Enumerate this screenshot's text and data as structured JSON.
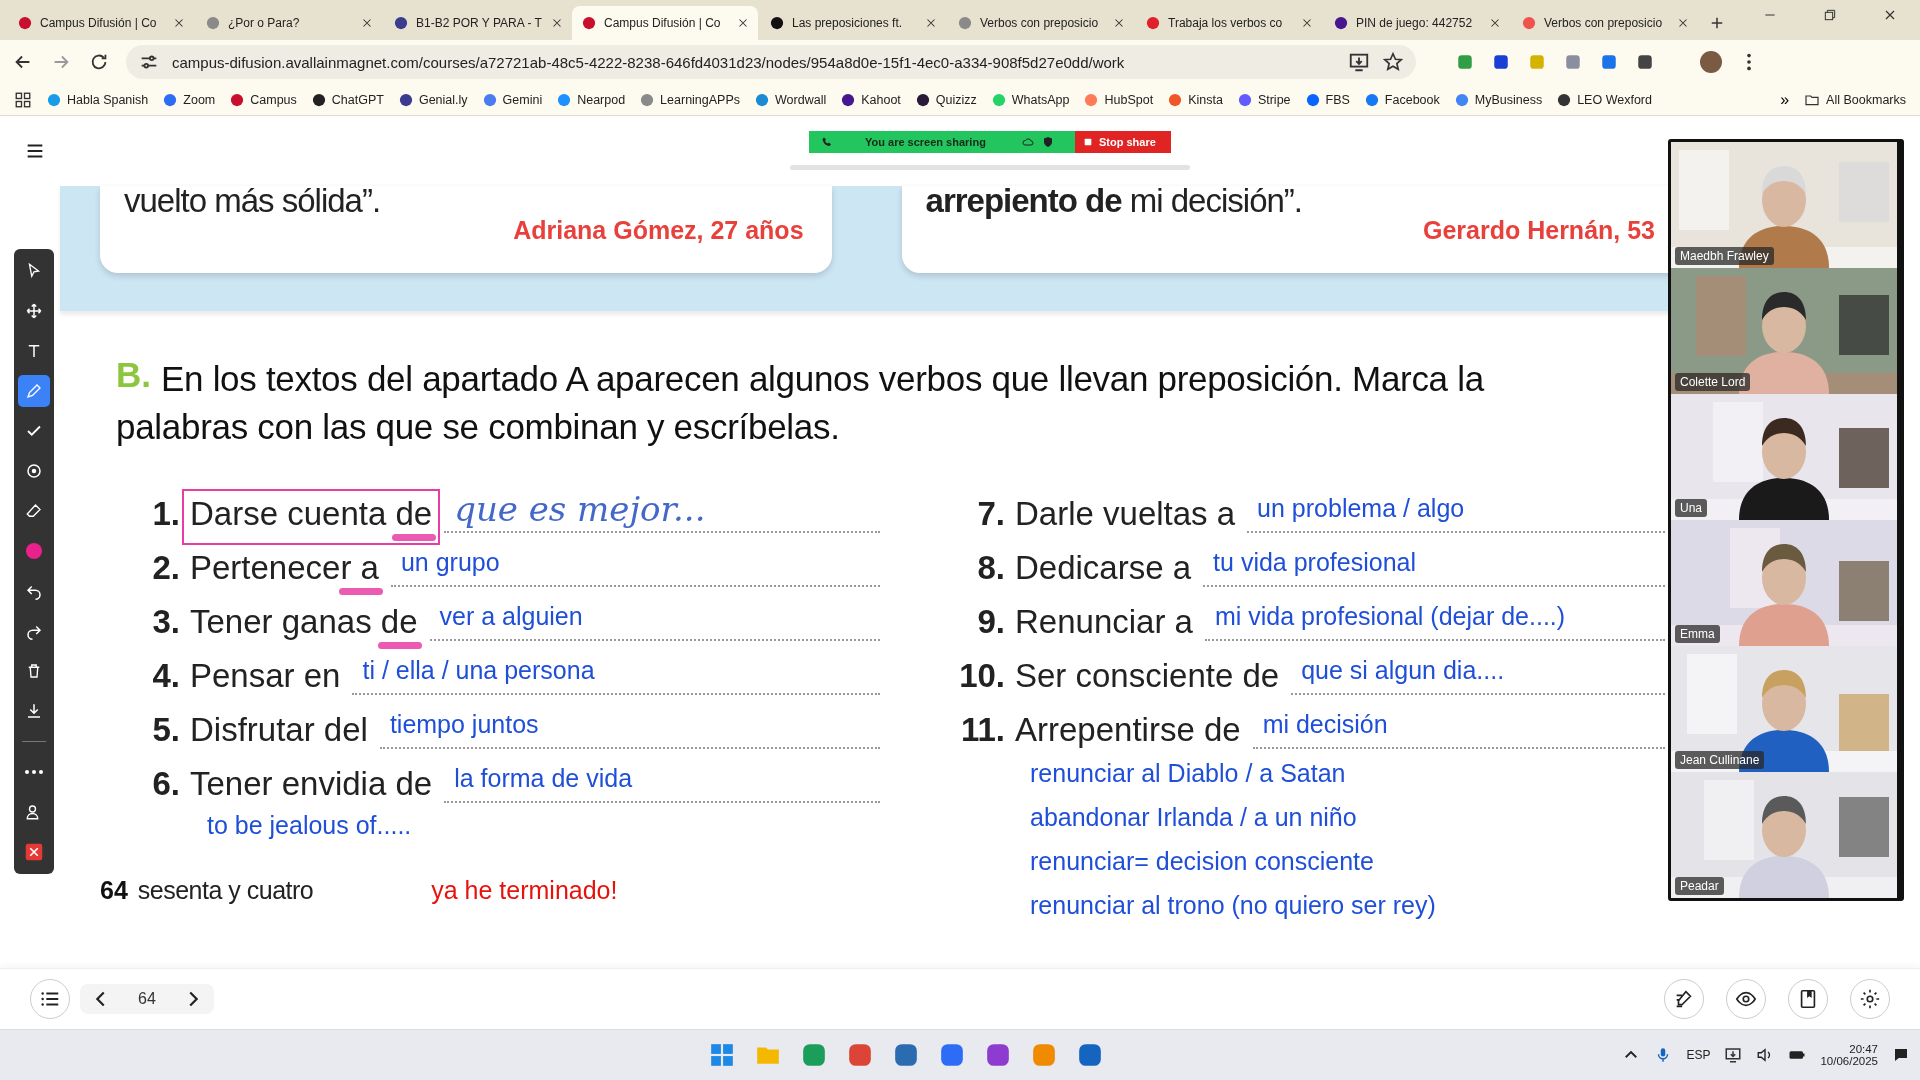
{
  "browser": {
    "tabs": [
      {
        "title": "Campus Difusión | Co",
        "selected": false,
        "color": "#c8102e"
      },
      {
        "title": "¿Por o Para?",
        "selected": false,
        "color": "#8a8a8a"
      },
      {
        "title": "B1-B2 POR Y PARA - T",
        "selected": false,
        "color": "#3b3b8f"
      },
      {
        "title": "Campus Difusión | Co",
        "selected": true,
        "color": "#c8102e"
      },
      {
        "title": "Las preposiciones ft.",
        "selected": false,
        "color": "#111111"
      },
      {
        "title": "Verbos con preposicio",
        "selected": false,
        "color": "#8a8a8a"
      },
      {
        "title": "Trabaja los verbos co",
        "selected": false,
        "color": "#e0202a"
      },
      {
        "title": "PIN de juego: 442752",
        "selected": false,
        "color": "#46178f"
      },
      {
        "title": "Verbos con preposicio",
        "selected": false,
        "color": "#ef5350"
      }
    ],
    "address": "campus-difusion.avallainmagnet.com/courses/a72721ab-48c5-4222-8238-646fd4031d23/nodes/954a8d0e-15f1-4ec0-a334-908f5d27e0dd/work",
    "bookmarks": [
      {
        "label": "Habla Spanish",
        "color": "#1a9be8"
      },
      {
        "label": "Zoom",
        "color": "#2d6cf5"
      },
      {
        "label": "Campus",
        "color": "#c8102e"
      },
      {
        "label": "ChatGPT",
        "color": "#222222"
      },
      {
        "label": "Genial.ly",
        "color": "#3b3b8f"
      },
      {
        "label": "Gemini",
        "color": "#4a7bf0"
      },
      {
        "label": "Nearpod",
        "color": "#1e90ff"
      },
      {
        "label": "LearningAPPs",
        "color": "#8a8a8a"
      },
      {
        "label": "Wordwall",
        "color": "#1a8ad4"
      },
      {
        "label": "Kahoot",
        "color": "#46178f"
      },
      {
        "label": "Quizizz",
        "color": "#2a1a3a"
      },
      {
        "label": "WhatsApp",
        "color": "#25d366"
      },
      {
        "label": "HubSpot",
        "color": "#ff7a59"
      },
      {
        "label": "Kinsta",
        "color": "#f0562a"
      },
      {
        "label": "Stripe",
        "color": "#635bff"
      },
      {
        "label": "FBS",
        "color": "#0866ff"
      },
      {
        "label": "Facebook",
        "color": "#1877f2"
      },
      {
        "label": "MyBusiness",
        "color": "#4285f4"
      },
      {
        "label": "LEO Wexford",
        "color": "#333333"
      }
    ],
    "overflow": "»",
    "all_bookmarks": "All Bookmarks"
  },
  "share_bar": {
    "status": "You are screen sharing",
    "stop": "Stop share"
  },
  "book": {
    "quotes": [
      {
        "text": "vuelto más sólida”.",
        "author": "Adriana Gómez, 27 años"
      },
      {
        "text": "**arrepiento de** mi decisión”.",
        "author": "Gerardo Hernán, 53"
      }
    ],
    "section": {
      "letter": "B.",
      "lines": [
        "En los textos del apartado A aparecen algunos verbos que llevan preposición. Marca la",
        "palabras con las que se combinan y escríbelas."
      ]
    },
    "left_items": [
      {
        "number": "1.",
        "label": "Darse cuenta de",
        "answer": "que es mejor...",
        "kind": "handwritten",
        "underlined": true,
        "boxed": true
      },
      {
        "number": "2.",
        "label": "Pertenecer a",
        "answer": "un grupo",
        "kind": "typed",
        "underlined": true,
        "boxed": false
      },
      {
        "number": "3.",
        "label": "Tener ganas de",
        "answer": "ver a alguien",
        "kind": "typed",
        "underlined": true,
        "boxed": false
      },
      {
        "number": "4.",
        "label": "Pensar en",
        "answer": "ti / ella / una persona",
        "kind": "typed",
        "underlined": false,
        "boxed": false
      },
      {
        "number": "5.",
        "label": "Disfrutar del",
        "answer": "tiempo juntos",
        "kind": "typed",
        "underlined": false,
        "boxed": false
      },
      {
        "number": "6.",
        "label": "Tener envidia de",
        "answer": "la forma de vida",
        "kind": "typed",
        "underlined": false,
        "boxed": false
      }
    ],
    "left_notes": [
      "to be jealous of....."
    ],
    "right_items": [
      {
        "number": "7.",
        "label": "Darle vueltas a",
        "answer": "un problema / algo",
        "kind": "typed",
        "underlined": false,
        "boxed": false
      },
      {
        "number": "8.",
        "label": "Dedicarse a",
        "answer": "tu vida profesional",
        "kind": "typed",
        "underlined": false,
        "boxed": false
      },
      {
        "number": "9.",
        "label": "Renunciar a",
        "answer": "mi vida profesional (dejar de....)",
        "kind": "typed",
        "underlined": false,
        "boxed": false
      },
      {
        "number": "10.",
        "label": "Ser consciente de",
        "answer": "que si algun dia....",
        "kind": "typed",
        "underlined": false,
        "boxed": false
      },
      {
        "number": "11.",
        "label": "Arrepentirse de",
        "answer": "mi decisión",
        "kind": "typed",
        "underlined": false,
        "boxed": false
      }
    ],
    "right_notes": [
      "renunciar al Diablo / a Satan",
      "abandonar Irlanda / a un niño",
      "renunciar= decision consciente",
      "renunciar al trono (no quiero ser rey)"
    ],
    "page_number": "64",
    "page_words": "sesenta y cuatro",
    "comment": "ya he terminado!"
  },
  "toolbar": {
    "tools": [
      {
        "kind": "pointer",
        "selected": false
      },
      {
        "kind": "move",
        "selected": false
      },
      {
        "kind": "text",
        "selected": false
      },
      {
        "kind": "pen",
        "selected": true
      },
      {
        "kind": "check",
        "selected": false
      },
      {
        "kind": "target",
        "selected": false
      },
      {
        "kind": "eraser",
        "selected": false
      },
      {
        "kind": "color",
        "selected": false,
        "color": "#e8218c"
      },
      {
        "kind": "undo",
        "selected": false
      },
      {
        "kind": "redo",
        "selected": false
      },
      {
        "kind": "trash",
        "selected": false
      },
      {
        "kind": "download",
        "selected": false
      },
      {
        "kind": "more",
        "selected": false
      },
      {
        "kind": "person",
        "selected": false
      },
      {
        "kind": "close",
        "selected": false
      }
    ]
  },
  "participants": [
    {
      "name": "Maedbh Frawley"
    },
    {
      "name": "Colette Lord"
    },
    {
      "name": "Una"
    },
    {
      "name": "Emma"
    },
    {
      "name": "Jean Cullinane"
    },
    {
      "name": "Peadar"
    }
  ],
  "reader_bar": {
    "page": "64"
  },
  "taskbar": {
    "language": "ESP",
    "time": "20:47",
    "date": "10/06/2025"
  }
}
